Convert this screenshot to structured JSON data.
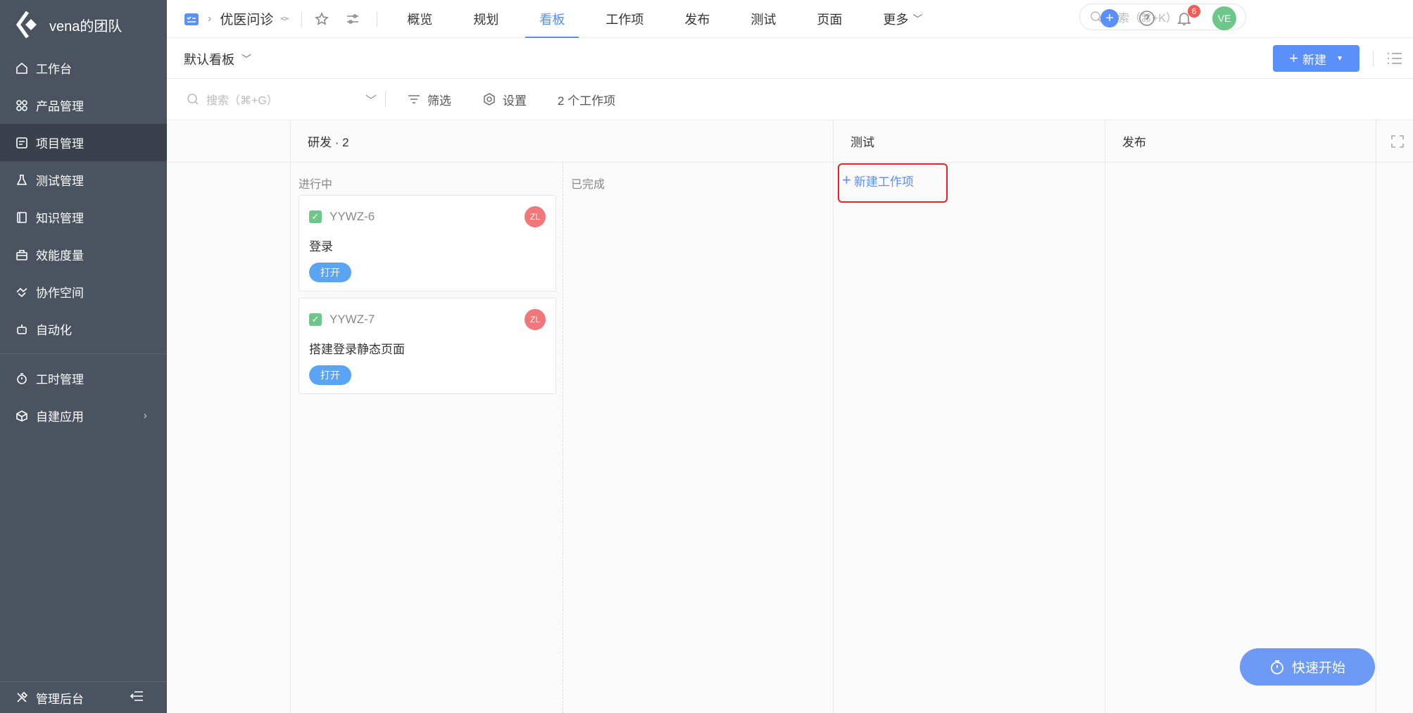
{
  "sidebar": {
    "team_name": "vena的团队",
    "items": [
      {
        "label": "工作台",
        "icon": "home-icon"
      },
      {
        "label": "产品管理",
        "icon": "grid-icon"
      },
      {
        "label": "项目管理",
        "icon": "project-icon",
        "active": true
      },
      {
        "label": "测试管理",
        "icon": "flask-icon"
      },
      {
        "label": "知识管理",
        "icon": "book-icon"
      },
      {
        "label": "效能度量",
        "icon": "briefcase-icon"
      },
      {
        "label": "协作空间",
        "icon": "handshake-icon"
      },
      {
        "label": "自动化",
        "icon": "robot-icon"
      },
      {
        "label": "工时管理",
        "icon": "timer-icon"
      },
      {
        "label": "自建应用",
        "icon": "cube-icon"
      }
    ],
    "admin_label": "管理后台"
  },
  "topbar": {
    "project_name": "优医问诊",
    "tabs": [
      {
        "label": "概览"
      },
      {
        "label": "规划"
      },
      {
        "label": "看板",
        "active": true
      },
      {
        "label": "工作项"
      },
      {
        "label": "发布"
      },
      {
        "label": "测试"
      },
      {
        "label": "页面"
      },
      {
        "label": "更多"
      }
    ],
    "search_placeholder": "搜索（⌘+K）",
    "notification_count": "6",
    "user_initials": "VE"
  },
  "board_bar": {
    "title": "默认看板",
    "new_button": "新建"
  },
  "filter_bar": {
    "search_placeholder": "搜索（⌘+G）",
    "filter_label": "筛选",
    "settings_label": "设置",
    "count_text": "2 个工作项"
  },
  "board": {
    "columns": [
      {
        "title": "研发 · 2"
      },
      {
        "title": "测试"
      },
      {
        "title": "发布"
      }
    ],
    "sub_columns": [
      "进行中",
      "已完成"
    ],
    "cards": [
      {
        "id": "YYWZ-6",
        "title": "登录",
        "status": "打开",
        "assignee": "ZL"
      },
      {
        "id": "YYWZ-7",
        "title": "搭建登录静态页面",
        "status": "打开",
        "assignee": "ZL"
      }
    ],
    "new_item_label": "新建工作项"
  },
  "quick_start_label": "快速开始",
  "colors": {
    "accent": "#5b8ff9",
    "sidebar_bg": "#4b5360",
    "highlight_border": "#f02020",
    "status_blue": "#5ba4f4",
    "avatar_red": "#f0777a",
    "avatar_green": "#6cc788"
  }
}
